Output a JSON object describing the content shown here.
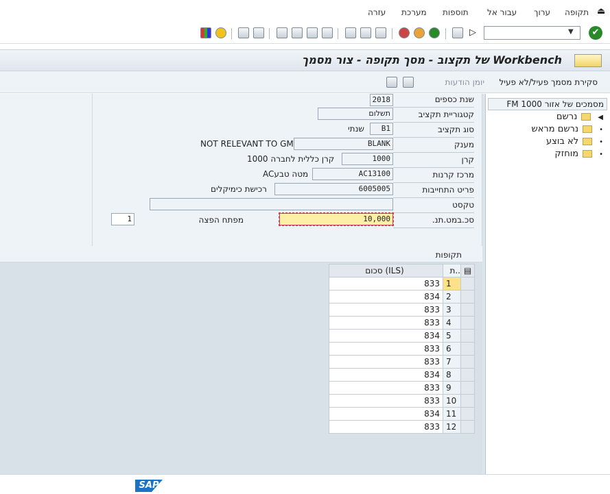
{
  "menu": {
    "items": [
      "תקופה",
      "ערוך",
      "עבור אל",
      "תוספות",
      "מערכת",
      "עזרה"
    ]
  },
  "toolbar": {
    "command_value": ""
  },
  "title": {
    "text": "Workbench של תקצוב - מסך תקופה - צור מסמך"
  },
  "app_toolbar": {
    "toggle_label": "סקירת מסמך פעיל/לא פעיל",
    "log_label": "יומן הודעות"
  },
  "form": {
    "fiscal_year_label": "שנת כספים",
    "fiscal_year_value": "2018",
    "budget_category_label": "קטגוריית תקציב",
    "budget_category_value": "תשלום",
    "budget_type_label": "סוג תקציב",
    "budget_type_value": "B1",
    "budget_type_desc": "שנתי",
    "grant_label": "מענק",
    "grant_value": "BLANK",
    "grant_desc": "NOT RELEVANT TO GM",
    "fund_label": "קרן",
    "fund_value": "1000",
    "fund_desc": "קרן כללית לחברה 1000",
    "funds_center_label": "מרכז קרנות",
    "funds_center_value": "AC13100",
    "funds_center_desc": "מטה טבעAC",
    "commitment_item_label": "פריט התחייבות",
    "commitment_item_value": "6005005",
    "commitment_item_desc": "רכישת כימיקלים",
    "text_label": "טקסט",
    "text_value": "",
    "total_label": "סכ.במט.תנ.",
    "total_value": "10,000",
    "distribution_key_label": "מפתח הפצה",
    "distribution_key_value": "1"
  },
  "periods": {
    "title": "תקופות",
    "col_number": "ת..",
    "col_amount": "סכום (ILS)",
    "rows": [
      {
        "n": "1",
        "amount": "833"
      },
      {
        "n": "2",
        "amount": "834"
      },
      {
        "n": "3",
        "amount": "833"
      },
      {
        "n": "4",
        "amount": "833"
      },
      {
        "n": "5",
        "amount": "834"
      },
      {
        "n": "6",
        "amount": "833"
      },
      {
        "n": "7",
        "amount": "833"
      },
      {
        "n": "8",
        "amount": "834"
      },
      {
        "n": "9",
        "amount": "833"
      },
      {
        "n": "10",
        "amount": "833"
      },
      {
        "n": "11",
        "amount": "834"
      },
      {
        "n": "12",
        "amount": "833"
      }
    ]
  },
  "tree": {
    "header": "מסמכים של אזור FM 1000",
    "items": [
      "נרשם",
      "נרשם מראש",
      "לא בוצע",
      "מוחזק"
    ]
  },
  "status": {
    "logo": "SAP"
  },
  "colors": {
    "accent": "#1a73c6",
    "highlight_field": "#fdf0a6",
    "selected_row": "#fde28a"
  }
}
